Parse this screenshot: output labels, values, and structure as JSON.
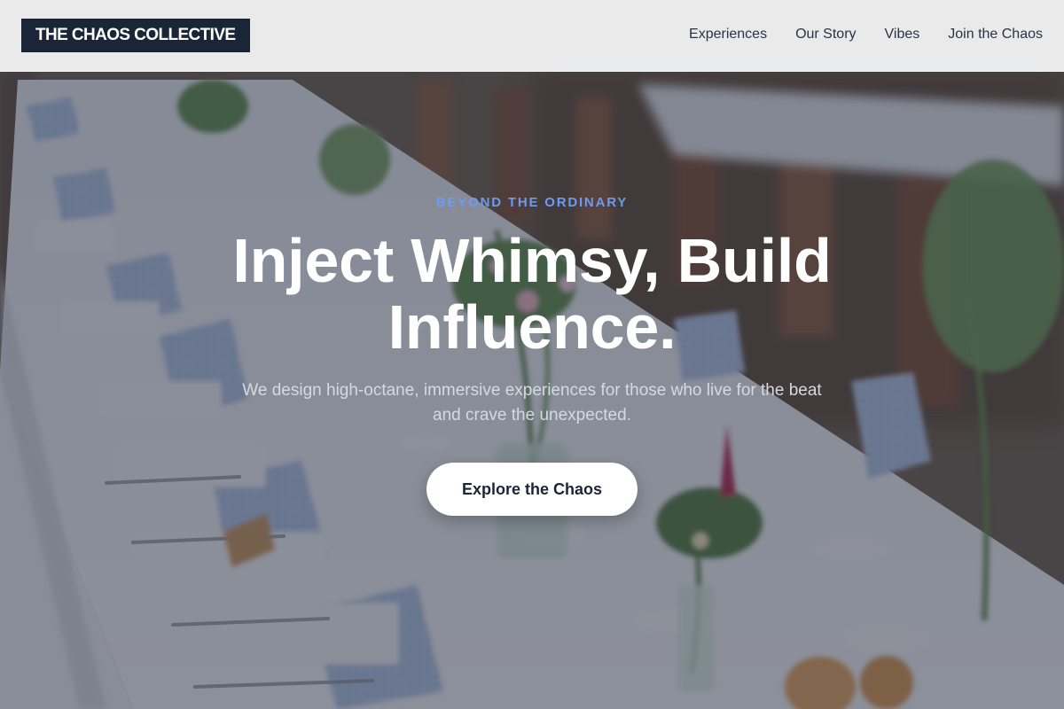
{
  "header": {
    "logo_text": "THE CHAOS COLLECTIVE",
    "nav": [
      {
        "label": "Experiences"
      },
      {
        "label": "Our Story"
      },
      {
        "label": "Vibes"
      },
      {
        "label": "Join the Chaos"
      }
    ]
  },
  "hero": {
    "eyebrow": "BEYOND THE ORDINARY",
    "headline": "Inject Whimsy, Build Influence.",
    "subhead": "We design high-octane, immersive experiences for those who live for the beat and crave the unexpected.",
    "cta_label": "Explore the Chaos"
  },
  "colors": {
    "logo_bg": "#1b2538",
    "accent": "#6e9bf0",
    "cta_bg": "#ffffff"
  }
}
